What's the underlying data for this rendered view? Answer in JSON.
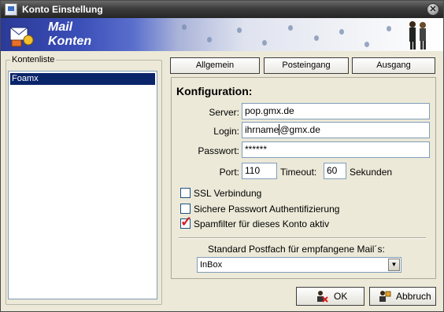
{
  "window": {
    "title": "Konto Einstellung"
  },
  "banner": {
    "line1": "Mail",
    "line2": "Konten"
  },
  "accounts": {
    "legend": "Kontenliste",
    "items": [
      "Foamx"
    ]
  },
  "tabs": [
    "Allgemein",
    "Posteingang",
    "Ausgang"
  ],
  "config": {
    "title": "Konfiguration:",
    "server_label": "Server:",
    "server_value": "pop.gmx.de",
    "login_label": "Login:",
    "login_value_before_caret": "ihrname",
    "login_value_after_caret": "@gmx.de",
    "password_label": "Passwort:",
    "password_value": "******",
    "port_label": "Port:",
    "port_value": "110",
    "timeout_label": "Timeout:",
    "timeout_value": "60",
    "timeout_unit": "Sekunden"
  },
  "options": {
    "ssl_label": "SSL Verbindung",
    "ssl_checked": false,
    "secure_auth_label": "Sichere Passwort Authentifizierung",
    "secure_auth_checked": false,
    "spam_label": "Spamfilter für dieses Konto aktiv",
    "spam_checked": true
  },
  "mailbox": {
    "label": "Standard Postfach für empfangene Mail´s:",
    "selected": "InBox"
  },
  "buttons": {
    "ok": "OK",
    "cancel": "Abbruch"
  },
  "colors": {
    "selection": "#0a246a",
    "checkmark": "#d81b1b",
    "window_bg": "#ece9d8"
  },
  "icons": {
    "close": "close-icon",
    "app": "app-icon",
    "mail": "mail-envelope-icon",
    "people": "people-icon",
    "ok": "user-check-icon",
    "cancel": "user-cancel-icon",
    "dropdown": "chevron-down-icon"
  }
}
